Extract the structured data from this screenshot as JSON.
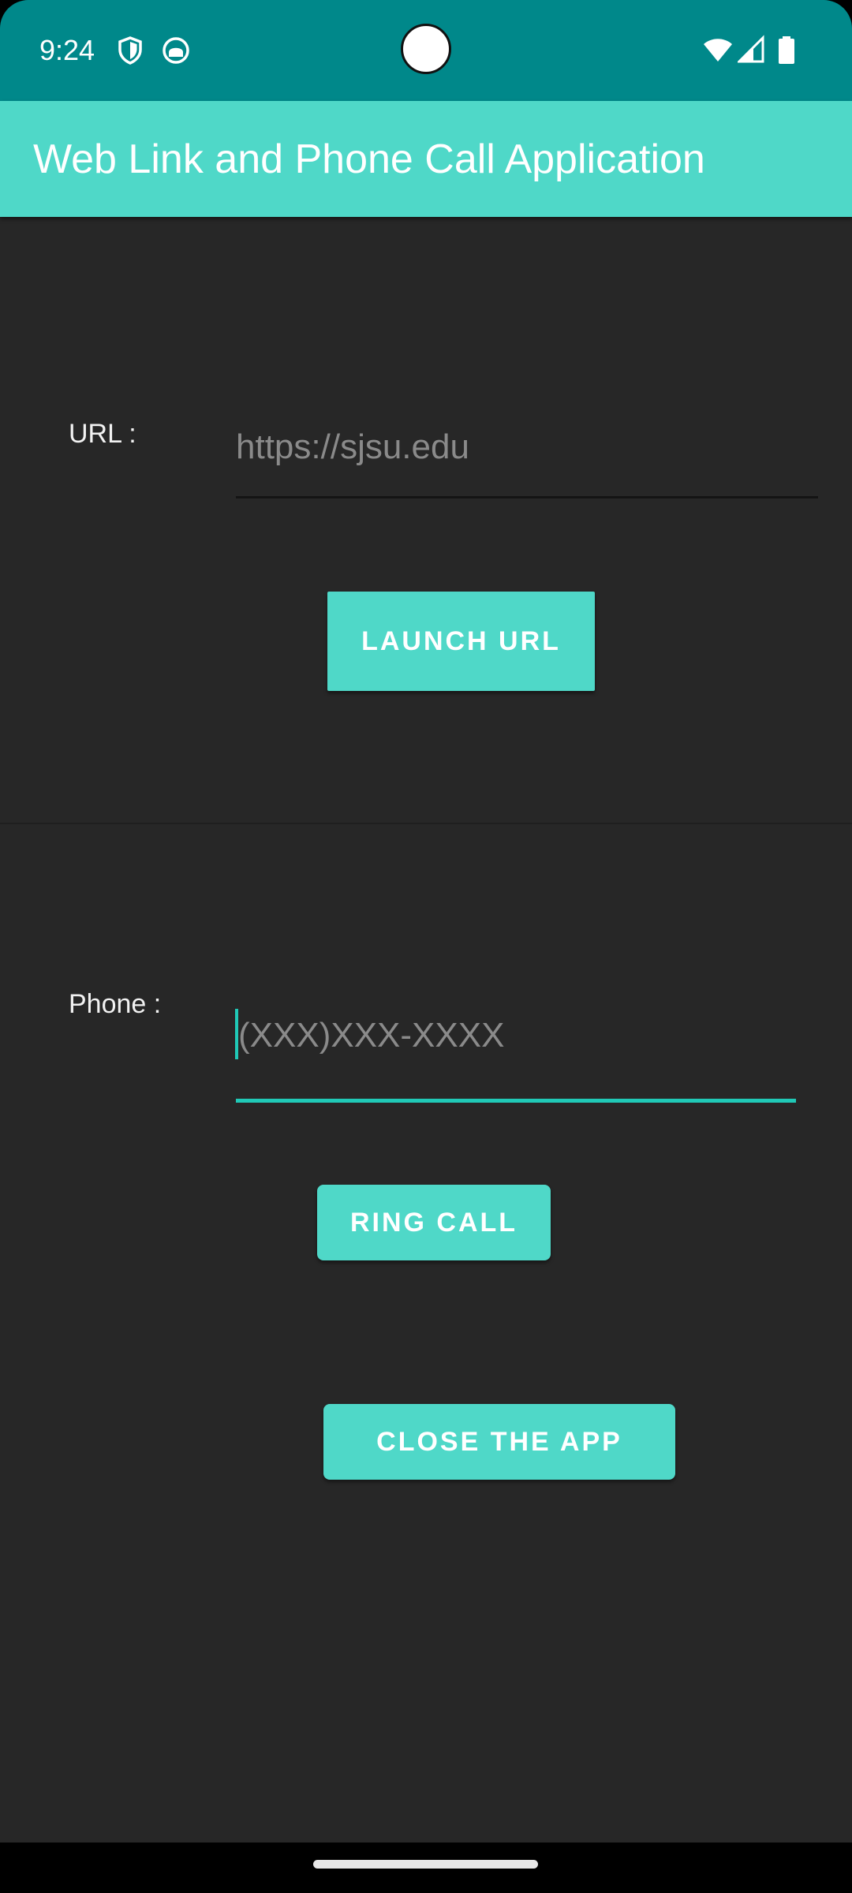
{
  "status_bar": {
    "time": "9:24",
    "icons": [
      "shield-icon",
      "android-icon",
      "wifi-icon",
      "signal-icon",
      "battery-icon"
    ]
  },
  "app_bar": {
    "title": "Web Link and Phone Call Application"
  },
  "url_section": {
    "label": "URL :",
    "placeholder": "https://sjsu.edu",
    "value": "",
    "button_label": "LAUNCH URL"
  },
  "phone_section": {
    "label": "Phone :",
    "placeholder": "(XXX)XXX-XXXX",
    "value": "",
    "button_label": "RING CALL"
  },
  "close_button_label": "CLOSE THE APP",
  "colors": {
    "status_bar": "#00888a",
    "accent": "#4fd8c8",
    "focus": "#20c9b7",
    "background": "#272727"
  }
}
